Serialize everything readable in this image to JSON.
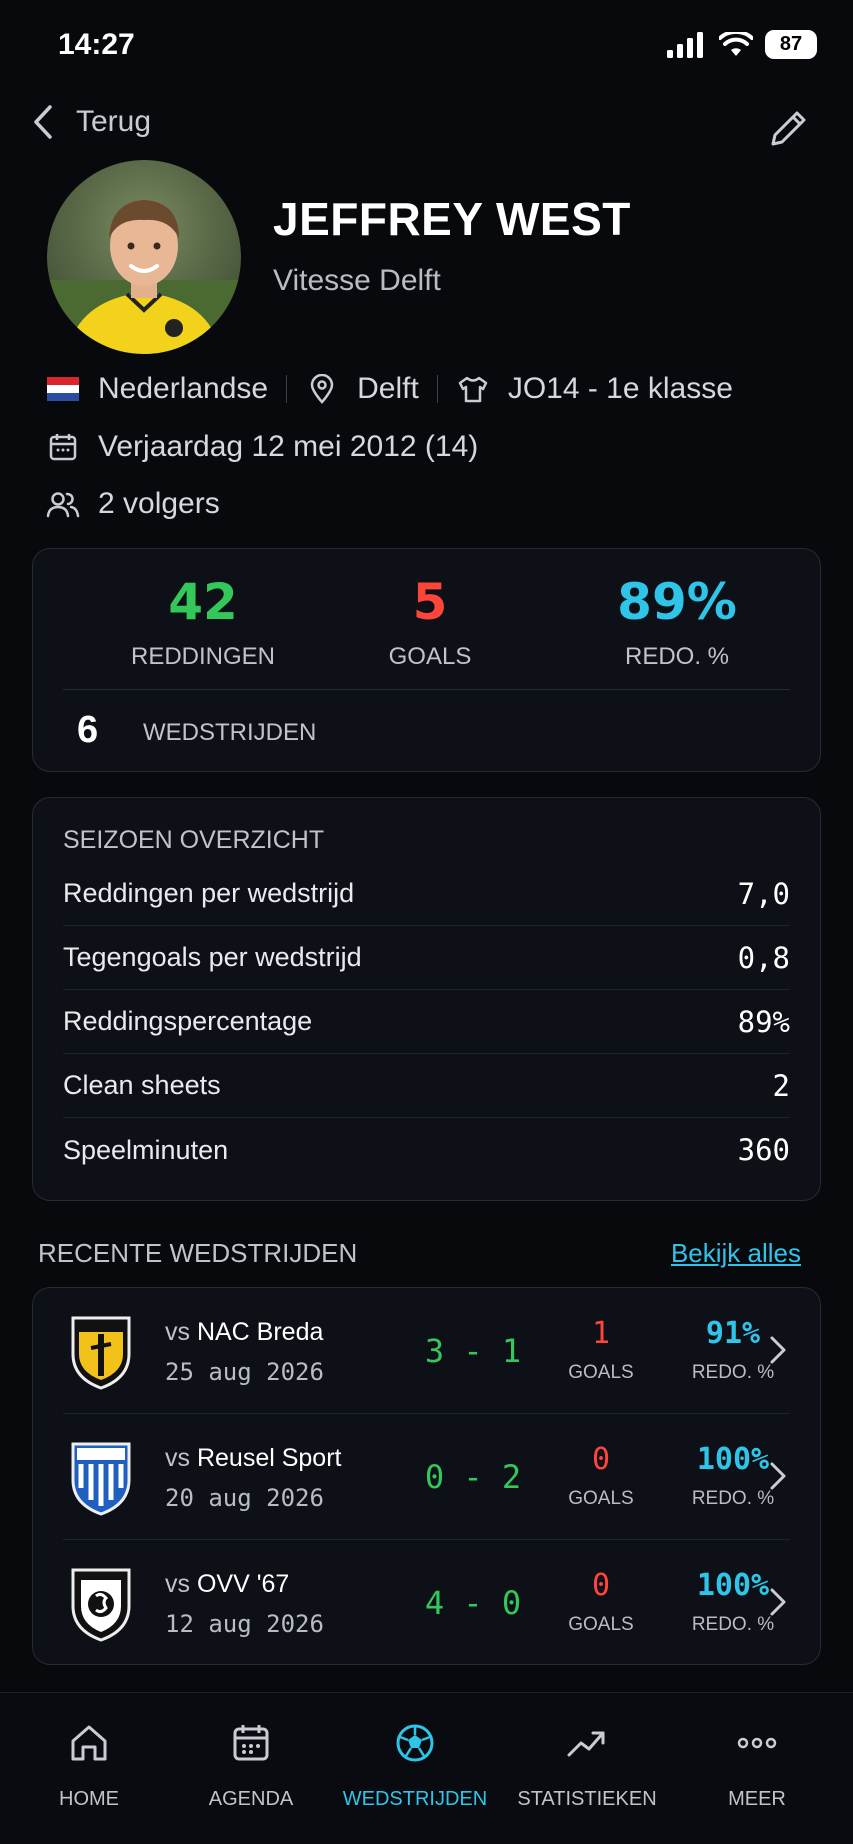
{
  "status_bar": {
    "time": "14:27",
    "battery": "87"
  },
  "header": {
    "back_label": "Terug"
  },
  "profile": {
    "name": "JEFFREY WEST",
    "club": "Vitesse Delft",
    "nationality": "Nederlandse",
    "city": "Delft",
    "team": "JO14 - 1e klasse",
    "birthday": "Verjaardag 12 mei 2012 (14)",
    "followers": "2 volgers"
  },
  "stats": {
    "saves": {
      "value": "42",
      "label": "REDDINGEN",
      "color": "#34c759"
    },
    "goals": {
      "value": "5",
      "label": "GOALS",
      "color": "#ff453a"
    },
    "save_pct": {
      "value": "89%",
      "label": "REDO. %",
      "color": "#2ec5e8"
    },
    "matches": {
      "value": "6",
      "label": "WEDSTRIJDEN"
    }
  },
  "season": {
    "title": "SEIZOEN OVERZICHT",
    "rows": [
      {
        "label": "Reddingen per wedstrijd",
        "value": "7,0"
      },
      {
        "label": "Tegengoals per wedstrijd",
        "value": "0,8"
      },
      {
        "label": "Reddingspercentage",
        "value": "89%"
      },
      {
        "label": "Clean sheets",
        "value": "2"
      },
      {
        "label": "Speelminuten",
        "value": "360"
      }
    ]
  },
  "recent": {
    "title": "RECENTE WEDSTRIJDEN",
    "see_all": "Bekijk alles",
    "matches": [
      {
        "vs": "vs",
        "opponent": "NAC Breda",
        "date": "25 aug 2026",
        "score": "3 - 1",
        "goals": "1",
        "goals_label": "GOALS",
        "pct": "91%",
        "pct_label": "REDO. %"
      },
      {
        "vs": "vs",
        "opponent": "Reusel Sport",
        "date": "20 aug 2026",
        "score": "0 - 2",
        "goals": "0",
        "goals_label": "GOALS",
        "pct": "100%",
        "pct_label": "REDO. %"
      },
      {
        "vs": "vs",
        "opponent": "OVV '67",
        "date": "12 aug 2026",
        "score": "4 - 0",
        "goals": "0",
        "goals_label": "GOALS",
        "pct": "100%",
        "pct_label": "REDO. %"
      }
    ]
  },
  "nav": {
    "items": [
      {
        "label": "HOME",
        "icon": "home-icon"
      },
      {
        "label": "AGENDA",
        "icon": "calendar-icon"
      },
      {
        "label": "WEDSTRIJDEN",
        "icon": "soccer-ball-icon",
        "active": true
      },
      {
        "label": "STATISTIEKEN",
        "icon": "trend-icon"
      },
      {
        "label": "MEER",
        "icon": "more-icon"
      }
    ]
  },
  "colors": {
    "accent": "#2ec5e8",
    "positive": "#34c759",
    "negative": "#ff453a",
    "background": "#07090d"
  }
}
